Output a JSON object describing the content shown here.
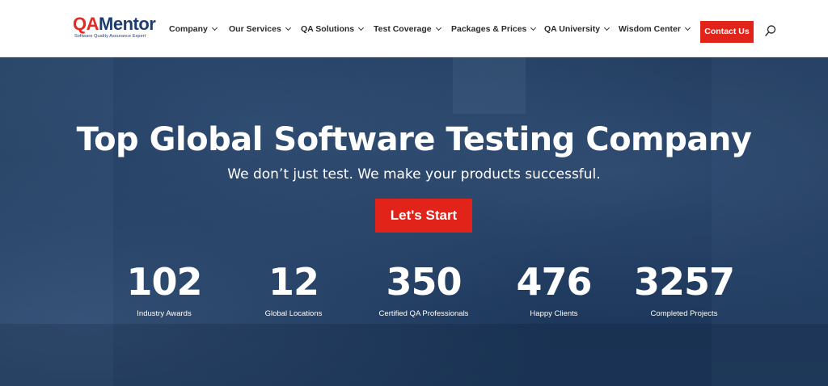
{
  "logo": {
    "letter_q": "Q",
    "letter_a": "A",
    "name_rest": "Mentor",
    "tagline": "Software Quality Assurance Expert"
  },
  "nav": {
    "items": [
      {
        "label": "Company"
      },
      {
        "label": "Our Services"
      },
      {
        "label": "QA Solutions"
      },
      {
        "label": "Test Coverage"
      },
      {
        "label": "Packages & Prices"
      },
      {
        "label": "QA University"
      },
      {
        "label": "Wisdom Center"
      }
    ],
    "contact_label": "Contact Us",
    "search_icon": "search-icon"
  },
  "hero": {
    "title": "Top Global Software Testing Company",
    "subtitle": "We don’t just test. We make your products successful.",
    "cta_label": "Let's Start"
  },
  "stats": [
    {
      "value": "102",
      "label": "Industry Awards"
    },
    {
      "value": "12",
      "label": "Global Locations"
    },
    {
      "value": "350",
      "label": "Certified QA Professionals"
    },
    {
      "value": "476",
      "label": "Happy Clients"
    },
    {
      "value": "3257",
      "label": "Completed Projects"
    }
  ],
  "colors": {
    "accent": "#e2231a",
    "brand_blue": "#1d3c6f",
    "hero_overlay": "#1f3a5c"
  }
}
